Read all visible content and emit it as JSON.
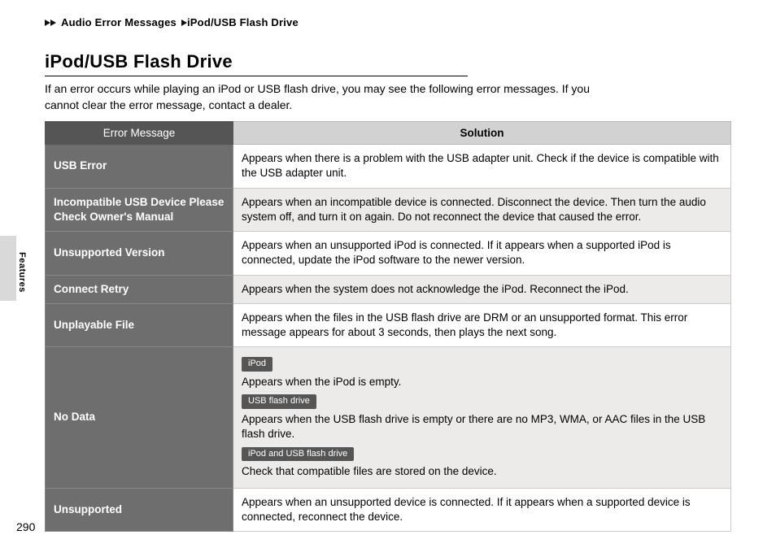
{
  "breadcrumb": {
    "level1": "Audio Error Messages",
    "level2": "iPod/USB Flash Drive"
  },
  "title": "iPod/USB Flash Drive",
  "intro": "If an error occurs while playing an iPod or USB flash drive, you may see the following error messages. If you cannot clear the error message, contact a dealer.",
  "table": {
    "headers": {
      "message": "Error Message",
      "solution": "Solution"
    },
    "rows": [
      {
        "message": "USB Error",
        "solution": "Appears when there is a problem with the USB adapter unit. Check if the device is compatible with the USB adapter unit."
      },
      {
        "message": "Incompatible USB Device Please Check Owner's Manual",
        "solution": "Appears when an incompatible device is connected. Disconnect the device. Then turn the audio system off, and turn it on again. Do not reconnect the device that caused the error."
      },
      {
        "message": "Unsupported Version",
        "solution": "Appears when an unsupported iPod is connected. If it appears when a supported iPod is connected, update the iPod software to the newer version."
      },
      {
        "message": "Connect Retry",
        "solution": "Appears when the system does not acknowledge the iPod. Reconnect the iPod."
      },
      {
        "message": "Unplayable File",
        "solution": "Appears when the files in the USB flash drive are DRM or an unsupported format. This error message appears for about 3 seconds, then plays the next song."
      },
      {
        "message": "No Data",
        "chips": {
          "ipod": "iPod",
          "usb": "USB flash drive",
          "both": "iPod and USB flash drive"
        },
        "lines": {
          "ipod": "Appears when the iPod is empty.",
          "usb": "Appears when the USB flash drive is empty or there are no MP3, WMA, or AAC files in the USB flash drive.",
          "both": "Check that compatible files are stored on the device."
        }
      },
      {
        "message": "Unsupported",
        "solution": "Appears when an unsupported device is connected. If it appears when a supported device is connected, reconnect the device."
      }
    ]
  },
  "side_tab": "Features",
  "page_number": "290"
}
